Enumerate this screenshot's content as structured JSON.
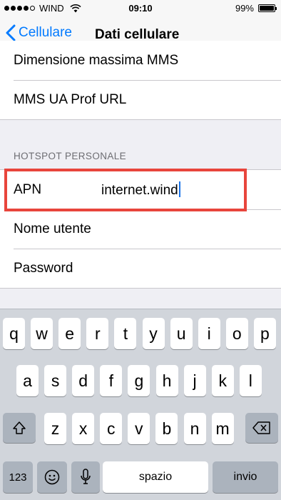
{
  "status_bar": {
    "carrier": "WIND",
    "time": "09:10",
    "battery": "99%",
    "battery_level": 0.99
  },
  "nav": {
    "back_label": "Cellulare",
    "title": "Dati cellulare"
  },
  "mms_rows": [
    "Dimensione massima MMS",
    "MMS UA Prof URL"
  ],
  "hotspot": {
    "header": "HOTSPOT PERSONALE",
    "apn_label": "APN",
    "apn_value": "internet.wind",
    "username_label": "Nome utente",
    "password_label": "Password"
  },
  "keyboard": {
    "row1": [
      "q",
      "w",
      "e",
      "r",
      "t",
      "y",
      "u",
      "i",
      "o",
      "p"
    ],
    "row2": [
      "a",
      "s",
      "d",
      "f",
      "g",
      "h",
      "j",
      "k",
      "l"
    ],
    "row3": [
      "z",
      "x",
      "c",
      "v",
      "b",
      "n",
      "m"
    ],
    "numbers_key": "123",
    "space_key": "spazio",
    "return_key": "invio"
  },
  "colors": {
    "accent": "#007aff",
    "highlight": "#e8453c"
  }
}
